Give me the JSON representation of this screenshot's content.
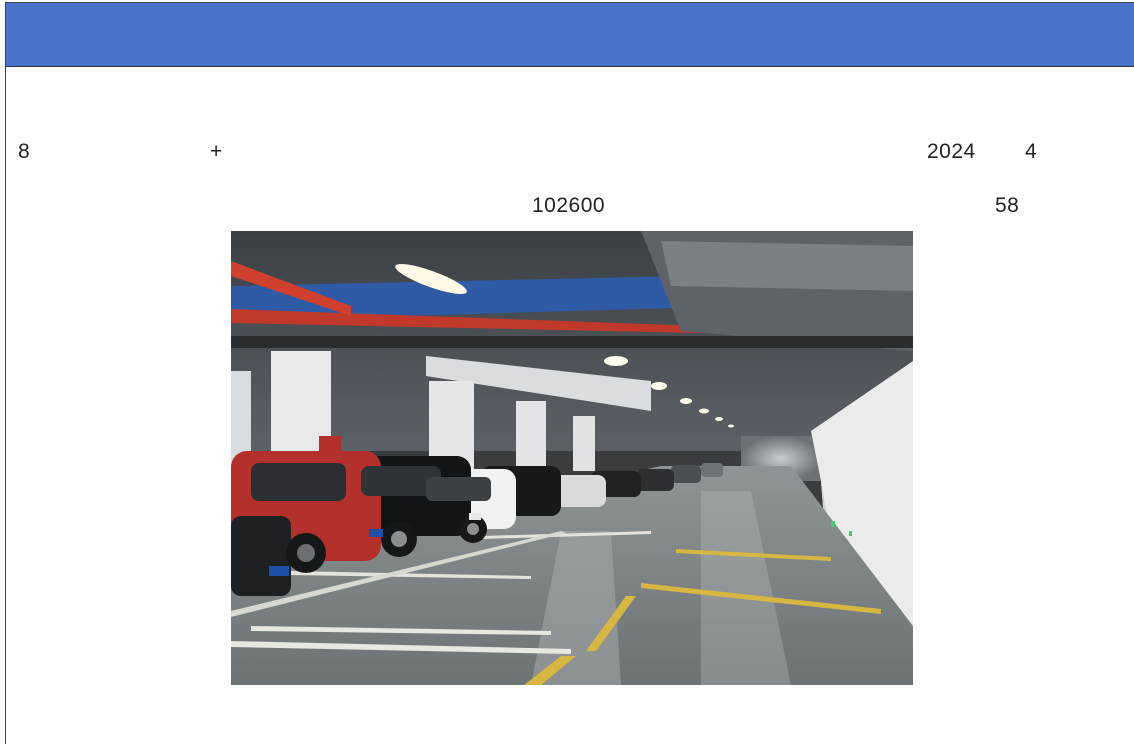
{
  "slide": {
    "header_color": "#4a74cc",
    "line1": {
      "lead_number": "8",
      "plus": "+",
      "year": "2024",
      "month": "4"
    },
    "line2": {
      "code": "102600",
      "count": "58"
    },
    "image": {
      "alt": "underground parking garage"
    }
  }
}
